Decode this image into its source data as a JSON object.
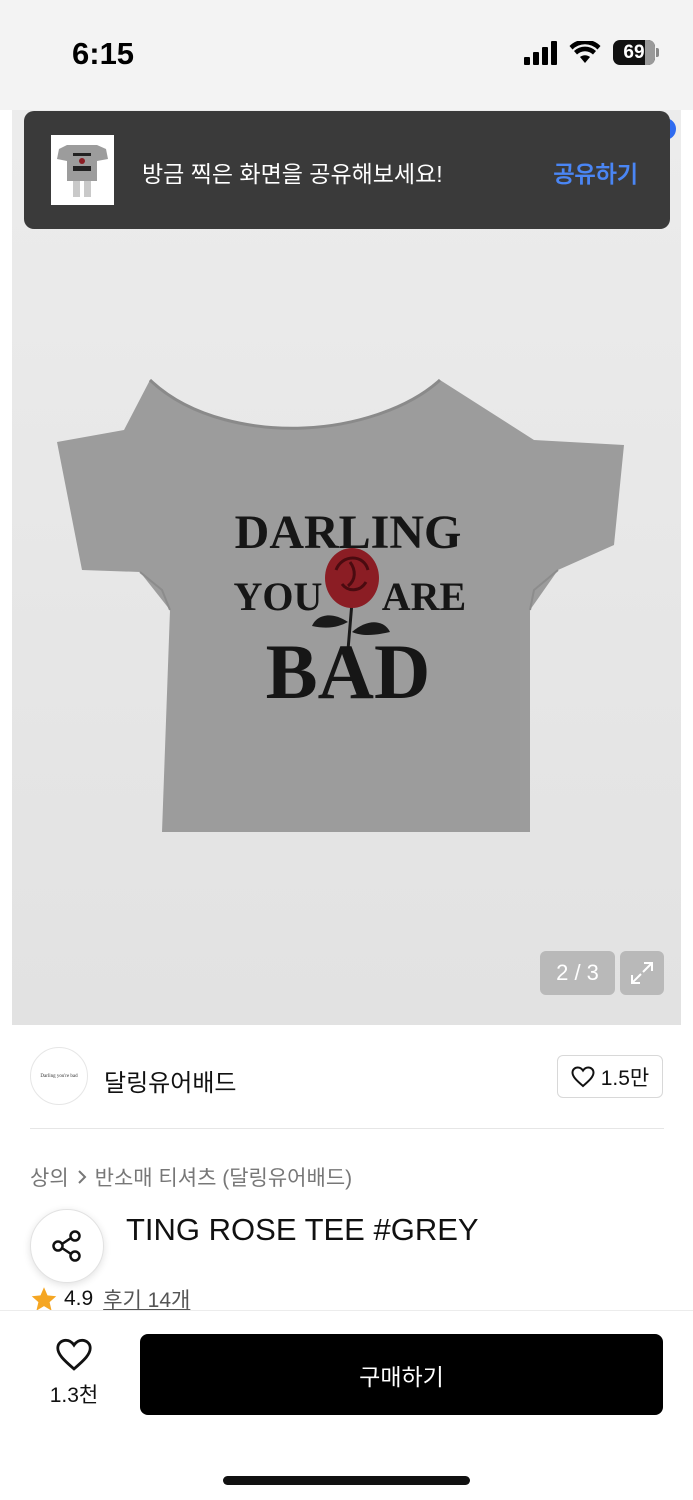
{
  "status_bar": {
    "time": "6:15",
    "battery": "69"
  },
  "toast": {
    "message": "방금 찍은 화면을 공유해보세요!",
    "action": "공유하기"
  },
  "product_image": {
    "print_line1": "DARLING",
    "print_line2_left": "YOU",
    "print_line2_right": "ARE",
    "print_line3": "BAD",
    "pager": "2 / 3"
  },
  "brand": {
    "logo_text": "Darling you're bad",
    "name": "달링유어배드",
    "likes": "1.5만"
  },
  "breadcrumb": {
    "category": "상의",
    "sub": "반소매 티셔츠 (달링유어배드)"
  },
  "product": {
    "title": "TING ROSE TEE #GREY",
    "rating": "4.9",
    "reviews": "후기 14개"
  },
  "bottom_bar": {
    "wish_count": "1.3천",
    "buy_label": "구매하기"
  },
  "colors": {
    "accent_blue": "#4a86f5",
    "star": "#f5a623",
    "shirt": "#9c9c9c",
    "rose": "#8b1d24"
  }
}
